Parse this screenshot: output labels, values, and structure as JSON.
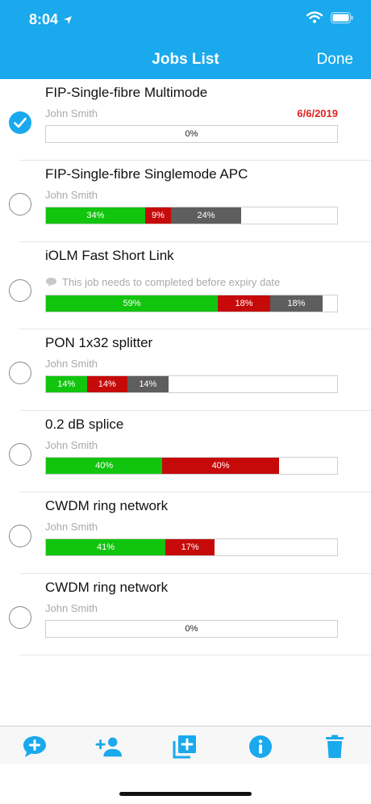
{
  "status": {
    "time": "8:04"
  },
  "nav": {
    "title": "Jobs List",
    "done_label": "Done"
  },
  "colors": {
    "accent": "#1aa9ec",
    "passed": "#11c50f",
    "failed": "#c60a0a",
    "other": "#5e5e5e",
    "date": "#e02424"
  },
  "jobs": [
    {
      "title": "FIP-Single-fibre Multimode",
      "user": "John Smith",
      "date": "6/6/2019",
      "checked": true,
      "progress": {
        "passed": 0,
        "failed": 0,
        "other": 0,
        "label": "0%"
      }
    },
    {
      "title": "FIP-Single-fibre Singlemode APC",
      "user": "John Smith",
      "checked": false,
      "progress": {
        "passed": 34,
        "failed": 9,
        "other": 24,
        "passed_label": "34%",
        "failed_label": "9%",
        "other_label": "24%"
      }
    },
    {
      "title": "iOLM Fast Short Link",
      "note": "This job needs to completed before expiry date",
      "checked": false,
      "progress": {
        "passed": 59,
        "failed": 18,
        "other": 18,
        "passed_label": "59%",
        "failed_label": "18%",
        "other_label": "18%"
      }
    },
    {
      "title": "PON 1x32 splitter",
      "user": "John Smith",
      "checked": false,
      "progress": {
        "passed": 14,
        "failed": 14,
        "other": 14,
        "passed_label": "14%",
        "failed_label": "14%",
        "other_label": "14%"
      }
    },
    {
      "title": "0.2 dB splice",
      "user": "John Smith",
      "checked": false,
      "progress": {
        "passed": 40,
        "failed": 40,
        "other": 0,
        "passed_label": "40%",
        "failed_label": "40%"
      }
    },
    {
      "title": "CWDM ring network",
      "user": "John Smith",
      "checked": false,
      "progress": {
        "passed": 41,
        "failed": 17,
        "other": 0,
        "passed_label": "41%",
        "failed_label": "17%"
      }
    },
    {
      "title": "CWDM ring network",
      "user": "John Smith",
      "checked": false,
      "progress": {
        "passed": 0,
        "failed": 0,
        "other": 0,
        "label": "0%"
      }
    }
  ],
  "toolbar": {
    "icons": [
      "add-comment-icon",
      "add-user-icon",
      "add-copy-icon",
      "info-icon",
      "trash-icon"
    ]
  }
}
